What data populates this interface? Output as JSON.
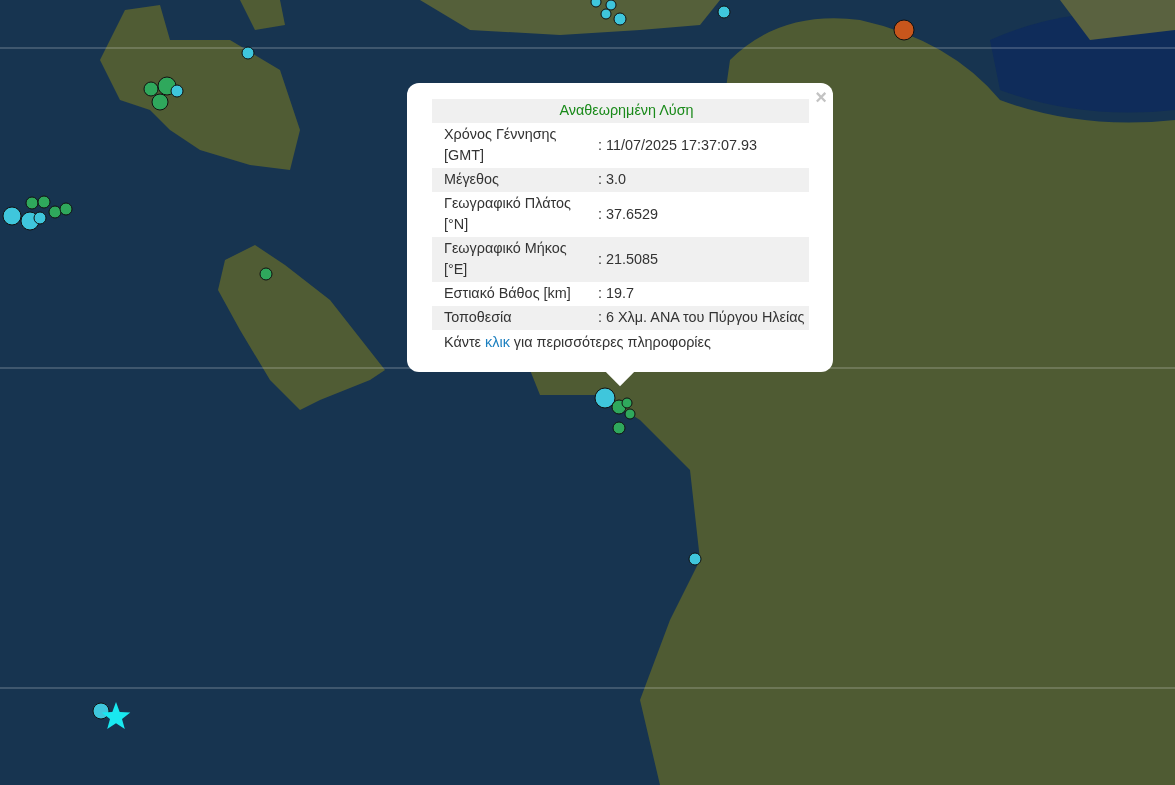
{
  "map": {
    "markers": [
      {
        "kind": "circle",
        "color": "#3fc6dc"
      },
      {
        "kind": "circle",
        "color": "#2fa85c"
      },
      {
        "kind": "circle",
        "color": "#2fa85c"
      },
      {
        "kind": "circle",
        "color": "#2fa85c"
      },
      {
        "kind": "circle",
        "color": "#3fc6dc"
      },
      {
        "kind": "circle",
        "color": "#3fc6dc"
      },
      {
        "kind": "circle",
        "color": "#3fc6dc"
      },
      {
        "kind": "circle",
        "color": "#2fa85c"
      },
      {
        "kind": "circle",
        "color": "#2fa85c"
      },
      {
        "kind": "circle",
        "color": "#3fc6dc"
      },
      {
        "kind": "circle",
        "color": "#2fa85c"
      },
      {
        "kind": "circle",
        "color": "#2fa85c"
      },
      {
        "kind": "circle",
        "color": "#2fa85c"
      },
      {
        "kind": "circle",
        "color": "#3fc6dc"
      },
      {
        "kind": "circle",
        "color": "#3fc6dc"
      },
      {
        "kind": "circle",
        "color": "#3fc6dc"
      },
      {
        "kind": "circle",
        "color": "#3fc6dc"
      },
      {
        "kind": "circle",
        "color": "#3fc6dc"
      },
      {
        "kind": "circle",
        "color": "#c8561c"
      },
      {
        "kind": "circle",
        "color": "#3fc6dc"
      },
      {
        "kind": "circle",
        "color": "#2fa85c"
      },
      {
        "kind": "circle",
        "color": "#2fa85c"
      },
      {
        "kind": "circle",
        "color": "#2fa85c"
      },
      {
        "kind": "circle",
        "color": "#2fa85c"
      },
      {
        "kind": "circle",
        "color": "#3fc6dc"
      },
      {
        "kind": "circle",
        "color": "#3fc6dc"
      },
      {
        "kind": "star",
        "color": "#19e8f0"
      }
    ]
  },
  "popup": {
    "close": "×",
    "title": "Αναθεωρημένη Λύση",
    "rows": [
      {
        "label": "Χρόνος Γέννησης [GMT]",
        "value": ": 11/07/2025 17:37:07.93"
      },
      {
        "label": "Μέγεθος",
        "value": ": 3.0"
      },
      {
        "label": "Γεωγραφικό Πλάτος [°N]",
        "value": ": 37.6529"
      },
      {
        "label": "Γεωγραφικό Μήκος [°E]",
        "value": ": 21.5085"
      },
      {
        "label": "Εστιακό Βάθος [km]",
        "value": ": 19.7"
      },
      {
        "label": "Τοποθεσία",
        "value": ": 6 Χλμ. ΑΝΑ του Πύργου Ηλείας"
      }
    ],
    "footer": {
      "before": "Κάντε ",
      "link": "κλικ",
      "after": " για περισσότερες πληροφορίες"
    }
  }
}
